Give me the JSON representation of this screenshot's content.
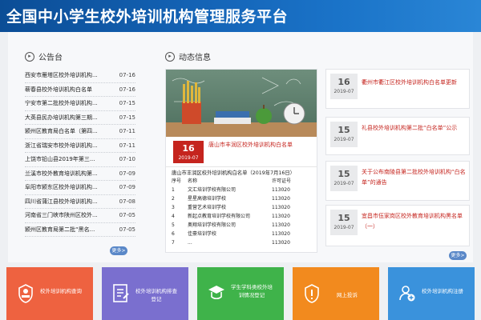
{
  "header": {
    "title": "全国中小学生校外培训机构管理服务平台"
  },
  "notices": {
    "heading": "公告台",
    "more": "更多>",
    "items": [
      {
        "title": "西安市雁塔区校外培训机构...",
        "date": "07-16"
      },
      {
        "title": "蕲春县校外培训机构白名单",
        "date": "07-16"
      },
      {
        "title": "宁安市第二批校外培训机构...",
        "date": "07-15"
      },
      {
        "title": "大英县民办培训机构第三期...",
        "date": "07-15"
      },
      {
        "title": "颍州区教育局白名单（第四...",
        "date": "07-11"
      },
      {
        "title": "浙江省瑞安市校外培训机构...",
        "date": "07-11"
      },
      {
        "title": "上饶市铅山县2019年第三...",
        "date": "07-10"
      },
      {
        "title": "兰溪市校外教育培训机构第...",
        "date": "07-09"
      },
      {
        "title": "阜阳市颍东区校外培训机构...",
        "date": "07-09"
      },
      {
        "title": "四川省蒲江县校外培训机构...",
        "date": "07-08"
      },
      {
        "title": "河南省三门峡市陕州区校外...",
        "date": "07-05"
      },
      {
        "title": "颍州区教育局第二批“黑名...",
        "date": "07-05"
      }
    ]
  },
  "news": {
    "heading": "动态信息",
    "more": "更多>",
    "feature": {
      "day": "16",
      "month": "2019-07",
      "title": "唐山市丰润区校外培训机构白名单"
    },
    "caption": "唐山市丰润区校外培训机构白名单（2019年7月16日）",
    "table": {
      "headers": [
        "序号",
        "名称",
        "许可证号"
      ],
      "rows": [
        [
          "1",
          "文汇培训学校有限公司",
          "113020"
        ],
        [
          "2",
          "星星高德培训学校",
          "113020"
        ],
        [
          "3",
          "重营艺术培训学校",
          "113020"
        ],
        [
          "4",
          "新起点教育培训学校有限公司",
          "113020"
        ],
        [
          "5",
          "奥翔培训学校有限公司",
          "113020"
        ],
        [
          "6",
          "佳豪培训学校",
          "113020"
        ],
        [
          "7",
          "...",
          "113020"
        ]
      ]
    },
    "items": [
      {
        "day": "16",
        "month": "2019-07",
        "title": "衢州市衢江区校外培训机构白名单更新"
      },
      {
        "day": "15",
        "month": "2019-07",
        "title": "礼县校外培训机构第二批“白名单”公示"
      },
      {
        "day": "15",
        "month": "2019-07",
        "title": "关于公布南陵县第二批校外培训机构“白名单”的通告"
      },
      {
        "day": "15",
        "month": "2019-07",
        "title": "宜昌市伍家岗区校外教育培训机构黑名单（一）"
      }
    ]
  },
  "tiles": [
    {
      "label": "校外培训机构查询",
      "icon": "person-stamp-icon",
      "color": "#ee6240"
    },
    {
      "label": "校外培训机构排查登记",
      "icon": "edit-document-icon",
      "color": "#7a6fcf"
    },
    {
      "label": "学生学科类校外培训情况登记",
      "icon": "student-book-icon",
      "color": "#3fb34a"
    },
    {
      "label": "网上投诉",
      "icon": "alert-shield-icon",
      "color": "#f28a1e"
    },
    {
      "label": "校外培训机构注册",
      "icon": "add-user-icon",
      "color": "#3a92dc"
    }
  ]
}
